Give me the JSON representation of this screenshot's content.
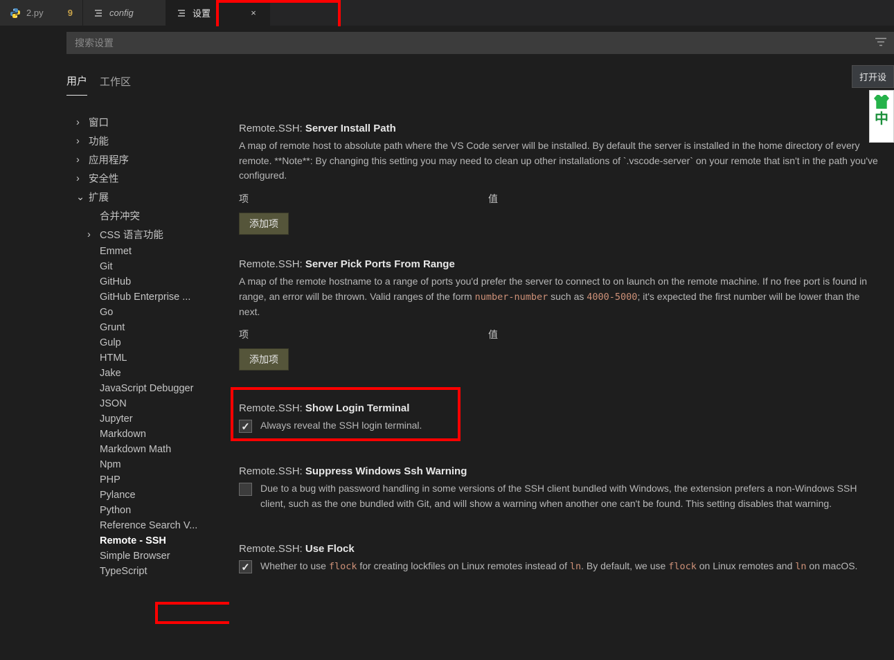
{
  "tabs": [
    {
      "label": "2.py",
      "icon": "python",
      "badge": "9"
    },
    {
      "label": "config",
      "icon": "list",
      "italic": true
    },
    {
      "label": "设置",
      "icon": "list",
      "active": true,
      "close": "×"
    }
  ],
  "search": {
    "placeholder": "搜索设置"
  },
  "scope_tabs": {
    "user": "用户",
    "workspace": "工作区",
    "open_json": "打开设"
  },
  "toc": [
    {
      "label": "窗口",
      "level": 0,
      "expand": "›"
    },
    {
      "label": "功能",
      "level": 0,
      "expand": "›"
    },
    {
      "label": "应用程序",
      "level": 0,
      "expand": "›"
    },
    {
      "label": "安全性",
      "level": 0,
      "expand": "›"
    },
    {
      "label": "扩展",
      "level": 0,
      "expand": "⌄"
    },
    {
      "label": "合并冲突",
      "level": 1
    },
    {
      "label": "CSS 语言功能",
      "level": 1,
      "expand": "›"
    },
    {
      "label": "Emmet",
      "level": 1
    },
    {
      "label": "Git",
      "level": 1
    },
    {
      "label": "GitHub",
      "level": 1
    },
    {
      "label": "GitHub Enterprise ...",
      "level": 1
    },
    {
      "label": "Go",
      "level": 1
    },
    {
      "label": "Grunt",
      "level": 1
    },
    {
      "label": "Gulp",
      "level": 1
    },
    {
      "label": "HTML",
      "level": 1
    },
    {
      "label": "Jake",
      "level": 1
    },
    {
      "label": "JavaScript Debugger",
      "level": 1
    },
    {
      "label": "JSON",
      "level": 1
    },
    {
      "label": "Jupyter",
      "level": 1
    },
    {
      "label": "Markdown",
      "level": 1
    },
    {
      "label": "Markdown Math",
      "level": 1
    },
    {
      "label": "Npm",
      "level": 1
    },
    {
      "label": "PHP",
      "level": 1
    },
    {
      "label": "Pylance",
      "level": 1
    },
    {
      "label": "Python",
      "level": 1
    },
    {
      "label": "Reference Search V...",
      "level": 1
    },
    {
      "label": "Remote - SSH",
      "level": 1,
      "active": true
    },
    {
      "label": "Simple Browser",
      "level": 1
    },
    {
      "label": "TypeScript",
      "level": 1
    }
  ],
  "kv": {
    "key_header": "项",
    "value_header": "值",
    "add_label": "添加项"
  },
  "settings": {
    "s1": {
      "prefix": "Remote.SSH: ",
      "title": "Server Install Path",
      "desc_plain": "A map of remote host to absolute path where the VS Code server will be installed. By default the server is installed in the home directory of every remote. **Note**: By changing this setting you may need to clean up other installations of `.vscode-server` on your remote that isn't in the path you've configured."
    },
    "s2": {
      "prefix": "Remote.SSH: ",
      "title": "Server Pick Ports From Range",
      "desc_pre": "A map of the remote hostname to a range of ports you'd prefer the server to connect to on launch on the remote machine. If no free port is found in range, an error will be thrown. Valid ranges of the form ",
      "code1": "number-number",
      "desc_mid": " such as ",
      "code2": "4000-5000",
      "desc_post": "; it's expected the first number will be lower than the next."
    },
    "s3": {
      "prefix": "Remote.SSH: ",
      "title": "Show Login Terminal",
      "check_label": "Always reveal the SSH login terminal."
    },
    "s4": {
      "prefix": "Remote.SSH: ",
      "title": "Suppress Windows Ssh Warning",
      "check_label": "Due to a bug with password handling in some versions of the SSH client bundled with Windows, the extension prefers a non-Windows SSH client, such as the one bundled with Git, and will show a warning when another one can't be found. This setting disables that warning."
    },
    "s5": {
      "prefix": "Remote.SSH: ",
      "title": "Use Flock",
      "desc_pre": "Whether to use ",
      "code1": "flock",
      "desc_mid1": " for creating lockfiles on Linux remotes instead of ",
      "code2": "ln",
      "desc_mid2": ". By default, we use ",
      "code3": "flock",
      "desc_mid3": " on Linux remotes and ",
      "code4": "ln",
      "desc_post": " on macOS."
    }
  },
  "float": {
    "text": "中"
  }
}
